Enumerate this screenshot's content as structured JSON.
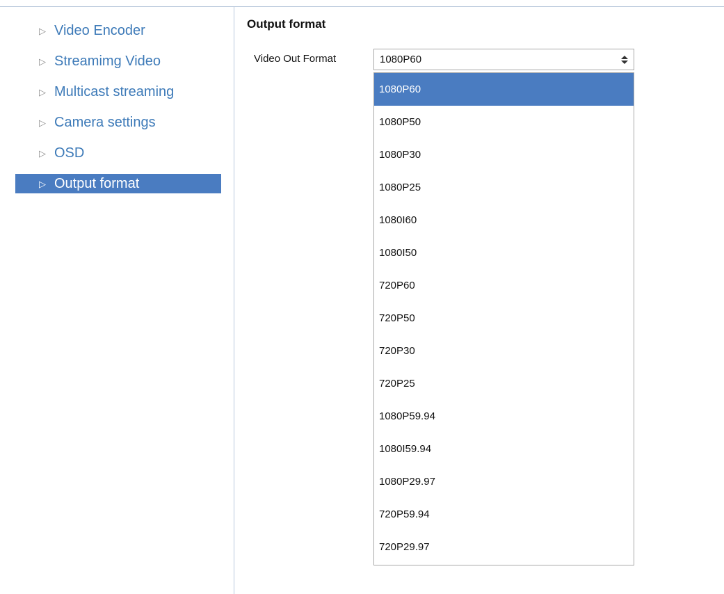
{
  "sidebar": {
    "items": [
      {
        "label": "Video Encoder",
        "active": false
      },
      {
        "label": "Streamimg Video",
        "active": false
      },
      {
        "label": "Multicast streaming",
        "active": false
      },
      {
        "label": "Camera settings",
        "active": false
      },
      {
        "label": "OSD",
        "active": false
      },
      {
        "label": "Output format",
        "active": true
      }
    ]
  },
  "main": {
    "title": "Output format",
    "video_out_format": {
      "label": "Video Out Format",
      "value": "1080P60",
      "options": [
        "1080P60",
        "1080P50",
        "1080P30",
        "1080P25",
        "1080I60",
        "1080I50",
        "720P60",
        "720P50",
        "720P30",
        "720P25",
        "1080P59.94",
        "1080I59.94",
        "1080P29.97",
        "720P59.94",
        "720P29.97"
      ]
    }
  },
  "colors": {
    "accent": "#4a7cc1",
    "link": "#3d7ab8",
    "divider": "#b9c8dc"
  }
}
